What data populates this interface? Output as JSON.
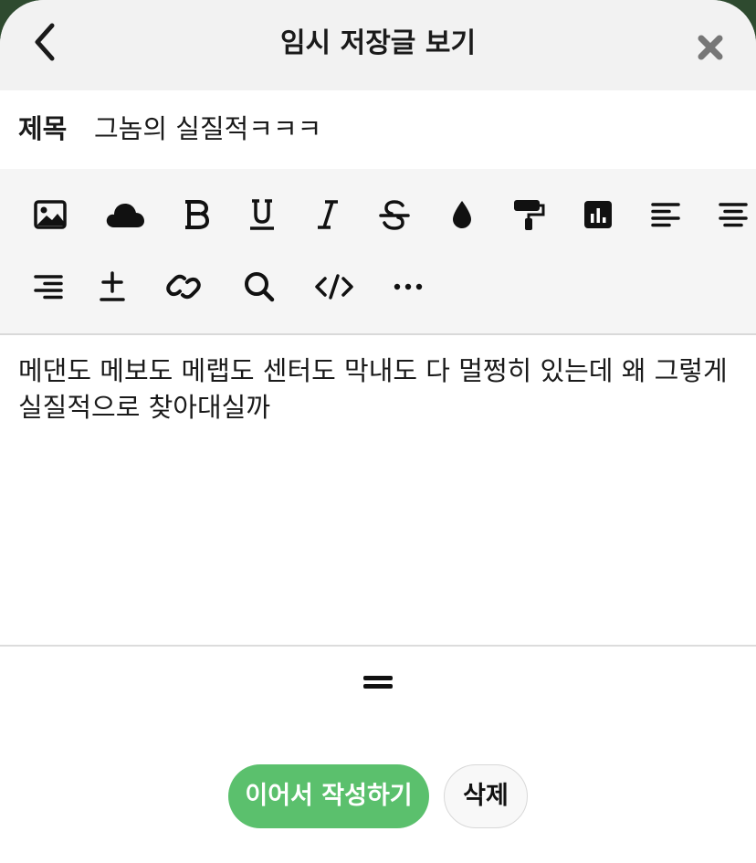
{
  "header": {
    "title": "임시 저장글 보기",
    "back_icon": "chevron-left-icon",
    "close_icon": "close-icon"
  },
  "post": {
    "title_label": "제목",
    "title_value": "그놈의 실질적ㅋㅋㅋ",
    "body": "메댄도 메보도 메랩도 센터도 막내도 다 멀쩡히 있는데 왜 그렇게 실질적으로 찾아대실까"
  },
  "toolbar": {
    "icons": [
      "image-icon",
      "cloud-icon",
      "bold-icon",
      "underline-icon",
      "italic-icon",
      "strikethrough-icon",
      "text-color-icon",
      "paint-roller-icon",
      "chart-icon",
      "align-left-icon",
      "align-center-icon",
      "align-right-icon",
      "plus-minus-icon",
      "link-icon",
      "search-icon",
      "code-icon",
      "more-icon"
    ]
  },
  "actions": {
    "continue_label": "이어서 작성하기",
    "delete_label": "삭제"
  },
  "colors": {
    "accent": "#5bc06d",
    "header_bg": "#f2f2f2",
    "toolbar_bg": "#f5f5f5",
    "backdrop": "#2e4a2f"
  }
}
